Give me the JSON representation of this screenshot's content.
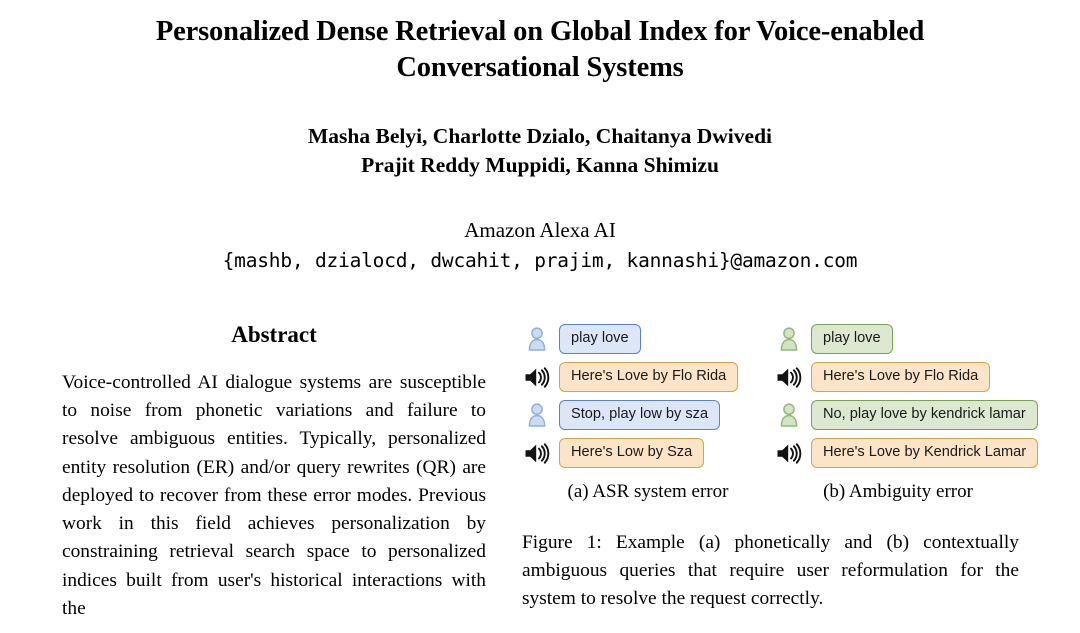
{
  "paper": {
    "title": "Personalized Dense Retrieval on Global Index for Voice-enabled Conversational Systems",
    "authors_line_1": "Masha Belyi, Charlotte Dzialo, Chaitanya Dwivedi",
    "authors_line_2": "Prajit Reddy Muppidi, Kanna Shimizu",
    "affiliation": "Amazon Alexa AI",
    "emails": "{mashb, dzialocd, dwcahit, prajim, kannashi}@amazon.com"
  },
  "abstract": {
    "heading": "Abstract",
    "body": "Voice-controlled AI dialogue systems are sus­ceptible to noise from phonetic variations and failure to resolve ambiguous entities. Typically, personalized entity resolution (ER) and/or query rewrites (QR) are deployed to recover from these error modes. Previous work in this field achieves personalization by constraining retrieval search space to personalized indices built from user's historical interactions with the"
  },
  "figure": {
    "caption": "Figure 1: Example (a) phonetically and (b) contextually ambiguous queries that require user reformulation for the system to resolve the request correctly.",
    "panels": [
      {
        "id": "a",
        "subcaption": "(a) ASR system error",
        "turns": [
          {
            "speaker": "user",
            "icon": "person-icon",
            "color": "user-blue",
            "text": "play love"
          },
          {
            "speaker": "system",
            "icon": "speaker-icon",
            "color": "system",
            "text": "Here's Love by Flo Rida"
          },
          {
            "speaker": "user",
            "icon": "person-icon",
            "color": "user-blue",
            "text": "Stop, play low by sza"
          },
          {
            "speaker": "system",
            "icon": "speaker-icon",
            "color": "system",
            "text": "Here's Low by Sza"
          }
        ]
      },
      {
        "id": "b",
        "subcaption": "(b) Ambiguity error",
        "turns": [
          {
            "speaker": "user",
            "icon": "person-icon",
            "color": "user-green",
            "text": "play love"
          },
          {
            "speaker": "system",
            "icon": "speaker-icon",
            "color": "system",
            "text": "Here's Love by Flo Rida"
          },
          {
            "speaker": "user",
            "icon": "person-icon",
            "color": "user-green",
            "text": "No, play love by kendrick lamar"
          },
          {
            "speaker": "system",
            "icon": "speaker-icon",
            "color": "system",
            "text": "Here's Love by Kendrick Lamar"
          }
        ]
      }
    ]
  },
  "colors": {
    "user_blue_fill": "#dce6f6",
    "user_blue_border": "#5b84c4",
    "user_green_fill": "#dce8d0",
    "user_green_border": "#7aa05c",
    "system_fill": "#fbe4c8",
    "system_border": "#d9a441",
    "person_blue": "#b9cce8",
    "person_green": "#c2d6ae",
    "speaker_black": "#111111"
  }
}
